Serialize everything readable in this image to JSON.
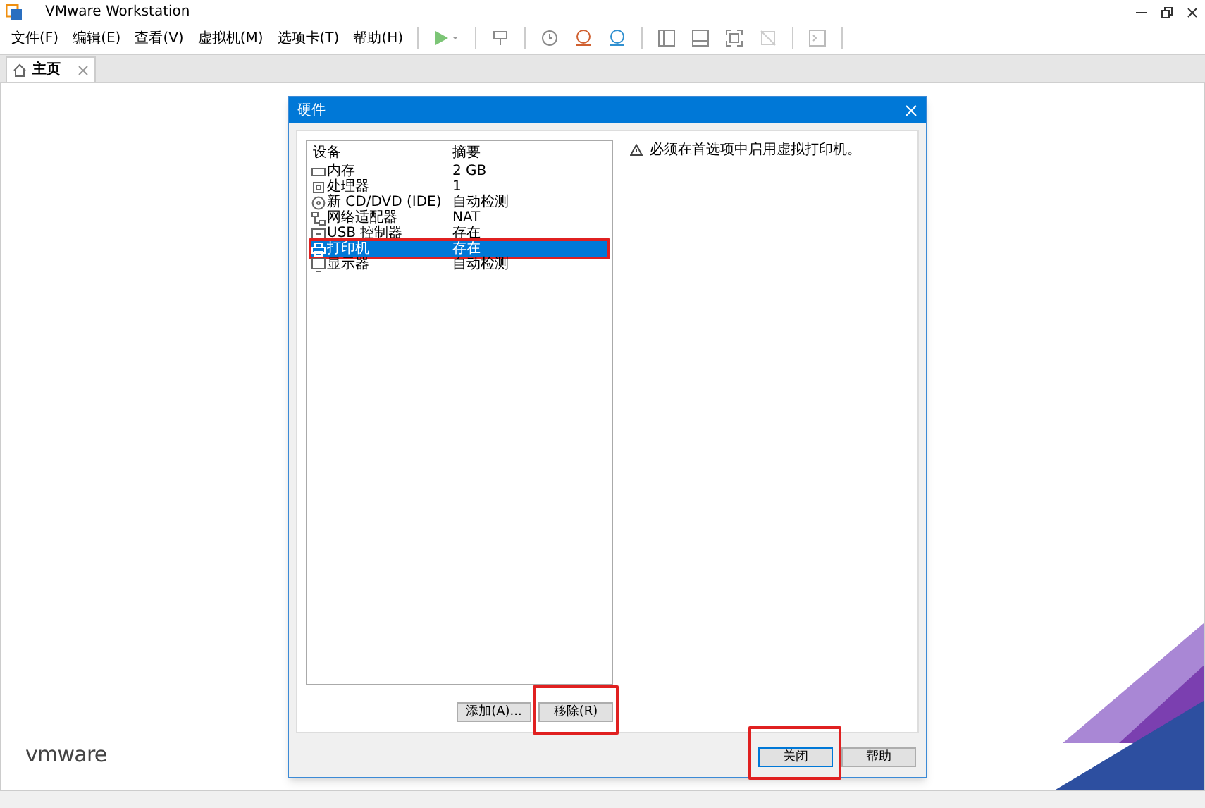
{
  "window": {
    "title": "VMware Workstation"
  },
  "menu": [
    "文件(F)",
    "编辑(E)",
    "查看(V)",
    "虚拟机(M)",
    "选项卡(T)",
    "帮助(H)"
  ],
  "tabs": [
    {
      "label": "主页",
      "selected": true
    }
  ],
  "logo": "vmware",
  "dialog": {
    "title": "硬件",
    "columns": [
      "设备",
      "摘要"
    ],
    "devices": [
      {
        "kind": "memory",
        "name": "内存",
        "summary": "2 GB",
        "selected": false
      },
      {
        "kind": "cpu",
        "name": "处理器",
        "summary": "1",
        "selected": false
      },
      {
        "kind": "disc",
        "name": "新 CD/DVD (IDE)",
        "summary": "自动检测",
        "selected": false
      },
      {
        "kind": "network",
        "name": "网络适配器",
        "summary": "NAT",
        "selected": false
      },
      {
        "kind": "usb",
        "name": "USB 控制器",
        "summary": "存在",
        "selected": false
      },
      {
        "kind": "printer",
        "name": "打印机",
        "summary": "存在",
        "selected": true,
        "highlighted": true
      },
      {
        "kind": "display",
        "name": "显示器",
        "summary": "自动检测",
        "selected": false
      }
    ],
    "warning": "必须在首选项中启用虚拟打印机。",
    "list_buttons": [
      {
        "label": "添加(A)...",
        "highlighted": false
      },
      {
        "label": "移除(R)",
        "highlighted": true
      }
    ],
    "footer_buttons": [
      {
        "label": "关闭",
        "default": true,
        "highlighted": true
      },
      {
        "label": "帮助",
        "default": false,
        "highlighted": false
      }
    ]
  }
}
